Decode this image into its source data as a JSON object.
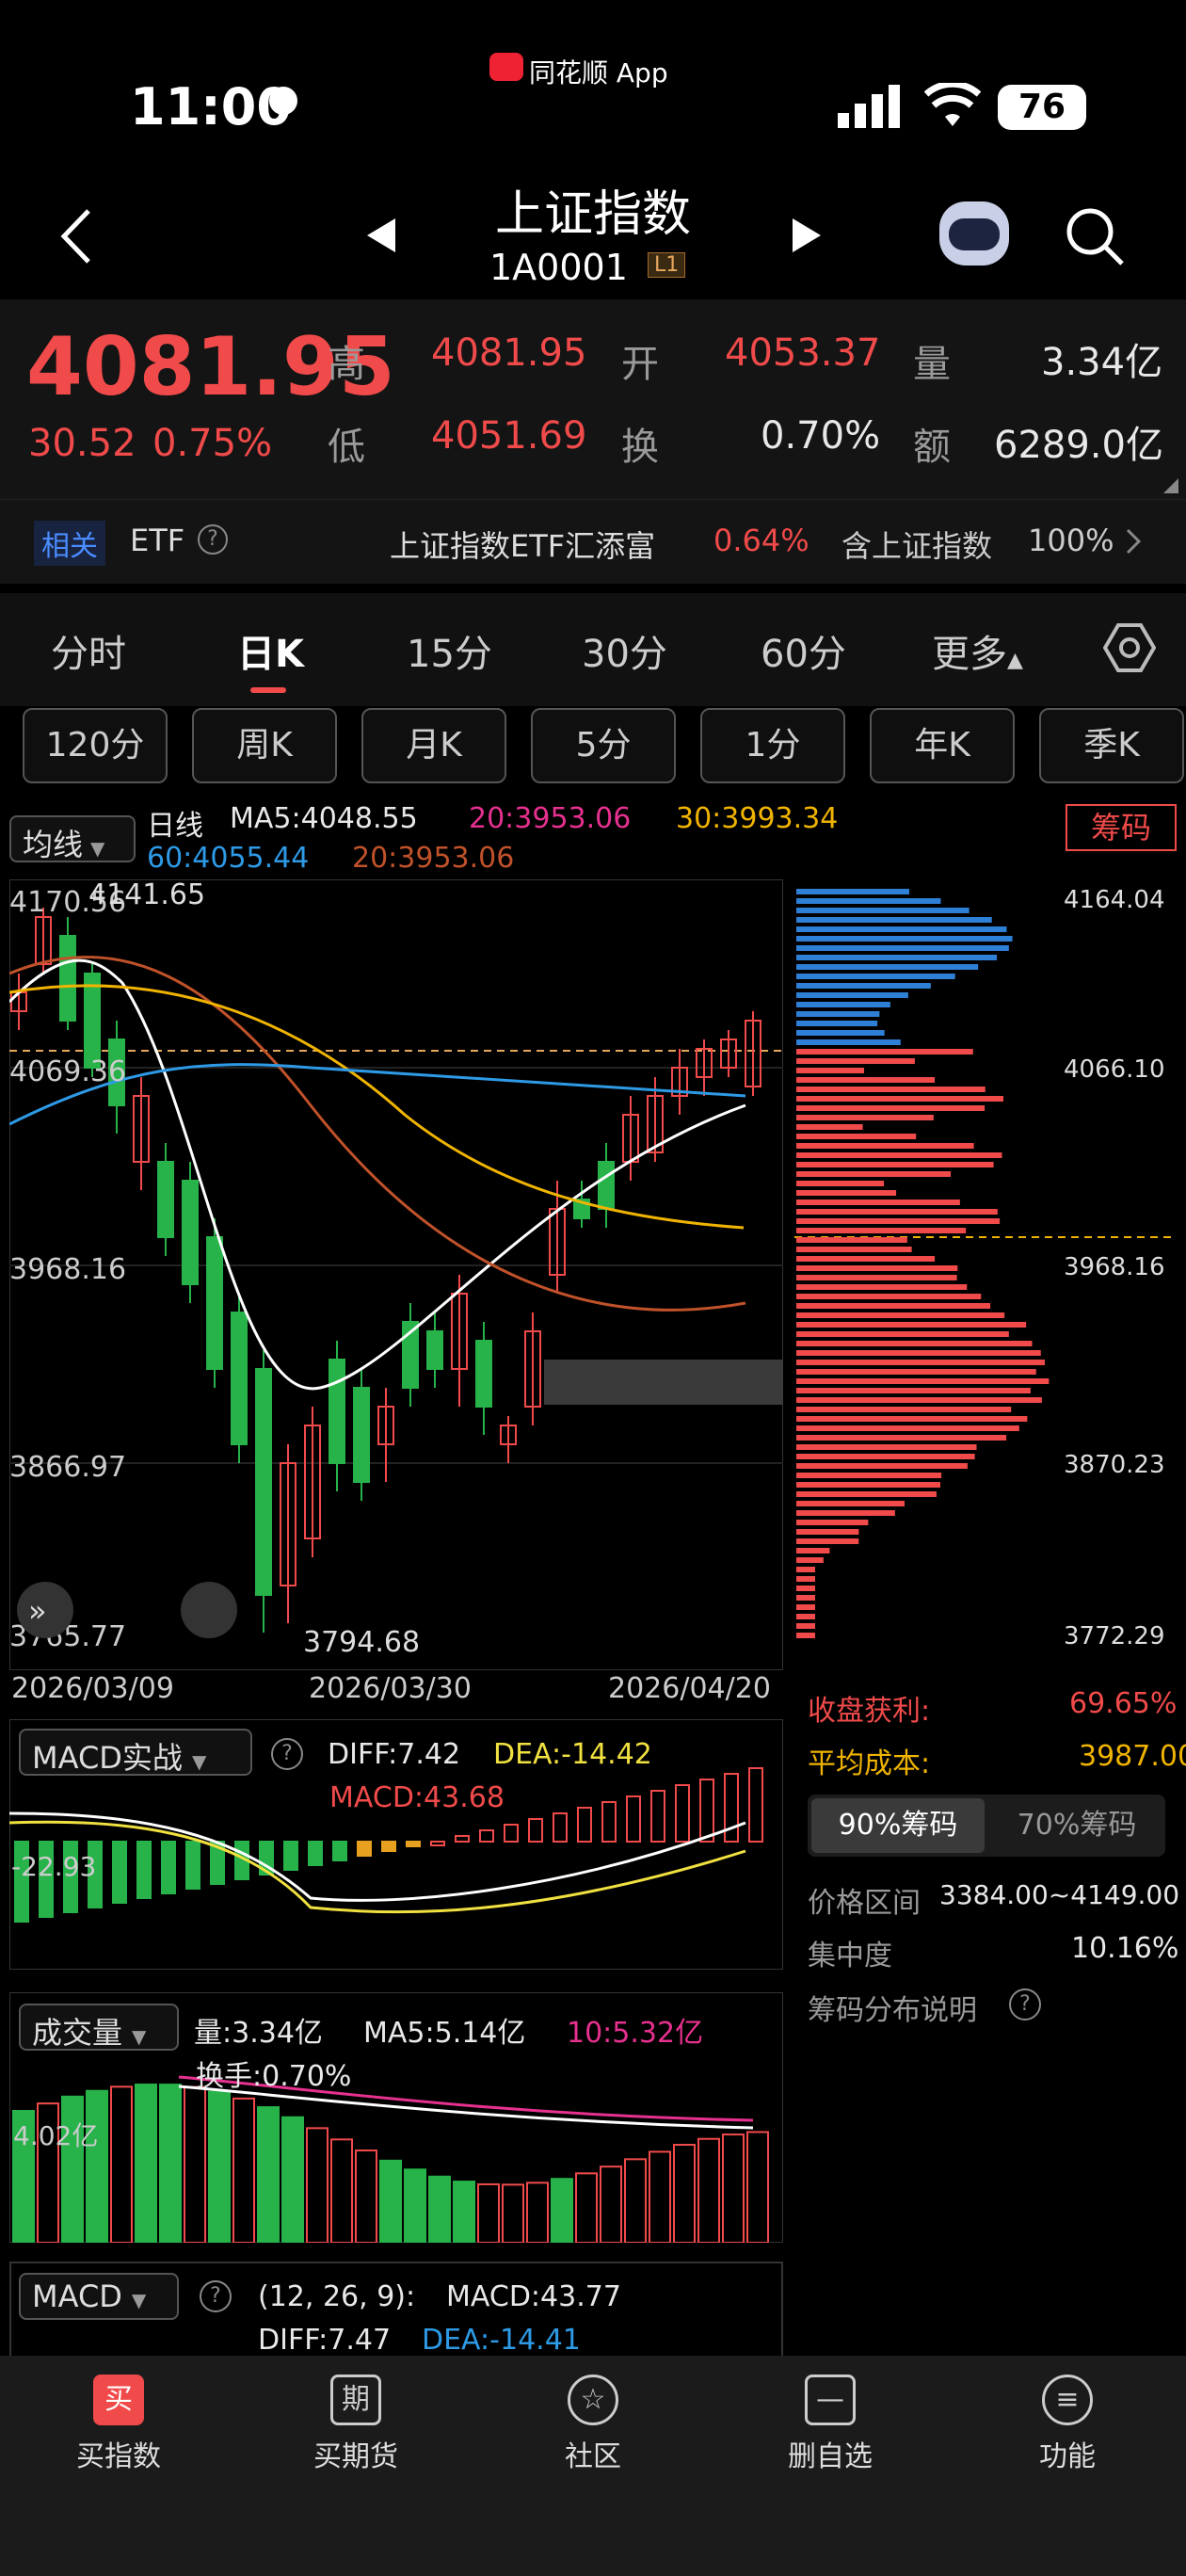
{
  "status": {
    "time": "11:00",
    "app": "同花顺 App",
    "battery": "76"
  },
  "header": {
    "title": "上证指数",
    "code": "1A0001",
    "level": "L1"
  },
  "quote": {
    "price": "4081.95",
    "change": "30.52",
    "pct": "0.75%",
    "high_label": "高",
    "high": "4081.95",
    "open_label": "开",
    "open": "4053.37",
    "vol_label": "量",
    "vol": "3.34亿",
    "low_label": "低",
    "low": "4051.69",
    "turn_label": "换",
    "turn": "0.70%",
    "amt_label": "额",
    "amt": "6289.0亿"
  },
  "related": {
    "tag": "相关",
    "etf": "ETF",
    "fund": "上证指数ETF汇添富",
    "fund_pct": "0.64%",
    "hold": "含上证指数",
    "hold_pct": "100%"
  },
  "tabs": [
    "分时",
    "日K",
    "15分",
    "30分",
    "60分",
    "更多"
  ],
  "subtabs": [
    "120分",
    "周K",
    "月K",
    "5分",
    "1分",
    "年K",
    "季K"
  ],
  "ma": {
    "btn": "均线",
    "label": "日线",
    "ma5": "MA5:4048.55",
    "ma20": "20:3953.06",
    "ma30": "30:3993.34",
    "ma60": "60:4055.44",
    "ma20b": "20:3953.06",
    "chip_btn": "筹码"
  },
  "axis": {
    "y1": "4170.56",
    "hi_mark": "4141.65",
    "y2": "4069.36",
    "y3": "3968.16",
    "y4": "3866.97",
    "y5": "3765.77",
    "lo_mark": "3794.68",
    "d1": "2026/03/09",
    "d2": "2026/03/30",
    "d3": "2026/04/20"
  },
  "chip_axis": {
    "p1": "4164.04",
    "p2": "4066.10",
    "p3": "3968.16",
    "p4": "3870.23",
    "p5": "3772.29"
  },
  "chip": {
    "profit_label": "收盘获利:",
    "profit": "69.65%",
    "avg_label": "平均成本:",
    "avg": "3987.00",
    "tab90": "90%筹码",
    "tab70": "70%筹码",
    "range_label": "价格区间",
    "range": "3384.00~4149.00",
    "conc_label": "集中度",
    "conc": "10.16%",
    "explain": "筹码分布说明"
  },
  "macd": {
    "btn": "MACD实战",
    "diff": "DIFF:7.42",
    "dea": "DEA:-14.42",
    "macd": "MACD:43.68",
    "axis": "-22.93"
  },
  "vol": {
    "btn": "成交量",
    "amount": "量:3.34亿",
    "ma5": "MA5:5.14亿",
    "ma10": "10:5.32亿",
    "turn": "换手:0.70%",
    "axis": "4.02亿"
  },
  "macd2": {
    "btn": "MACD",
    "params": "(12, 26, 9):",
    "macd": "MACD:43.77",
    "diff": "DIFF:7.47",
    "dea": "DEA:-14.41"
  },
  "nav": [
    "买指数",
    "买期货",
    "社区",
    "删自选",
    "功能"
  ],
  "nav_icons": [
    "买",
    "期",
    "☆",
    "—",
    "≡"
  ],
  "colors": {
    "up": "#f04a4a",
    "down": "#27b34a",
    "ma5": "#ffffff",
    "ma20": "#e6318f",
    "ma30": "#f0b400",
    "ma60": "#2e9ae6"
  }
}
